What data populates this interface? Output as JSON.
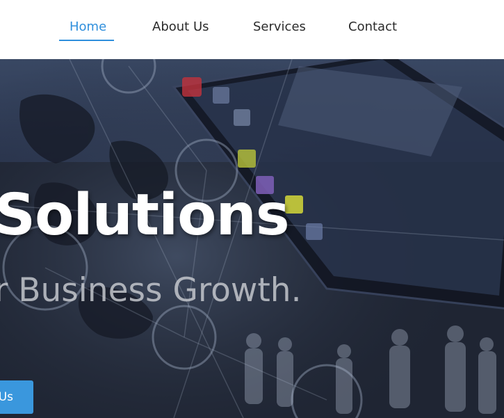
{
  "nav": {
    "items": [
      {
        "label": "Home",
        "active": true
      },
      {
        "label": "About Us",
        "active": false
      },
      {
        "label": "Services",
        "active": false
      },
      {
        "label": "Contact",
        "active": false
      }
    ]
  },
  "hero": {
    "title": "Solutions",
    "subtitle": "r Business Growth.",
    "button_label": "Us"
  },
  "colors": {
    "accent": "#2f8fdc",
    "button": "#3a97dd",
    "nav_text": "#2b2b2b",
    "hero_overlay": "#1e2535"
  }
}
